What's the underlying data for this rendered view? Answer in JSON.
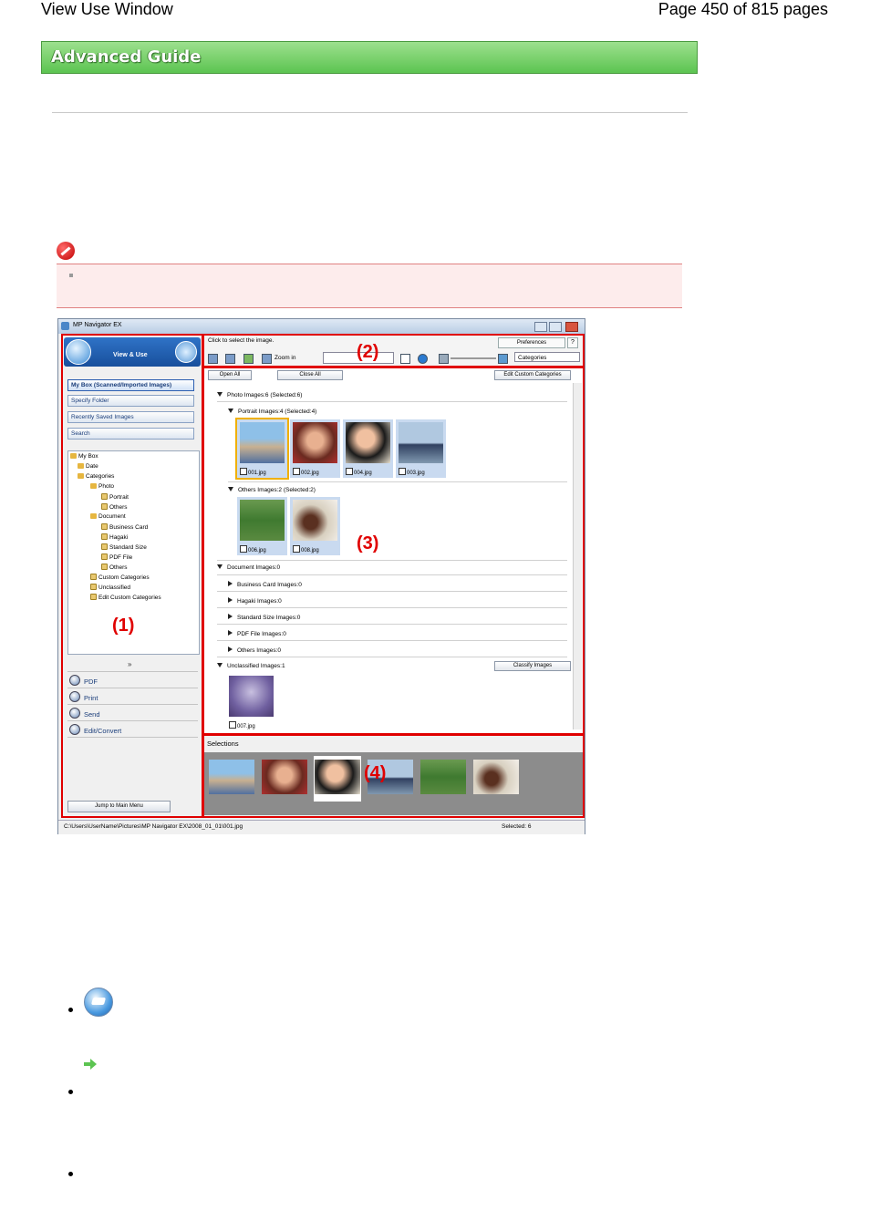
{
  "page_header": {
    "left": "View Use Window",
    "right": "Page 450 of 815 pages"
  },
  "banner": {
    "title": "Advanced Guide"
  },
  "screenshot": {
    "title": "MP Navigator EX",
    "left_panel": {
      "mode_label": "View & Use",
      "buttons": [
        "My Box (Scanned/Imported Images)",
        "Specify Folder",
        "Recently Saved Images",
        "Search"
      ],
      "tree": [
        "My Box",
        "Date",
        "Categories",
        "Photo",
        "Portrait",
        "Others",
        "Document",
        "Business Card",
        "Hagaki",
        "Standard Size",
        "PDF File",
        "Others",
        "Custom Categories",
        "Unclassified",
        "Edit Custom Categories"
      ],
      "actions": [
        "PDF",
        "Print",
        "Send",
        "Edit/Convert"
      ],
      "jump_button": "Jump to Main Menu"
    },
    "toolbar": {
      "hint": "Click to select the image.",
      "preferences": "Preferences",
      "help": "?",
      "zoom": "Zoom in",
      "category_select": "Categories"
    },
    "content": {
      "open_all": "Open All",
      "close_all": "Close All",
      "edit_custom": "Edit Custom Categories",
      "classify": "Classify Images",
      "sections": [
        "Photo    Images:6    (Selected:6)",
        "Portrait    Images:4    (Selected:4)",
        "Others    Images:2    (Selected:2)",
        "Document    Images:0",
        "Business Card    Images:0",
        "Hagaki    Images:0",
        "Standard Size    Images:0",
        "PDF File    Images:0",
        "Others    Images:0",
        "Unclassified    Images:1"
      ],
      "files": [
        "001.jpg",
        "002.jpg",
        "004.jpg",
        "003.jpg",
        "006.jpg",
        "008.jpg",
        "007.jpg"
      ]
    },
    "selections_label": "Selections",
    "status": {
      "path": "C:\\Users\\UserName\\Pictures\\MP Navigator EX\\2008_01_01\\001.jpg",
      "selected": "Selected: 6"
    },
    "region_numbers": [
      "(1)",
      "(2)",
      "(3)",
      "(4)"
    ]
  },
  "colors": {
    "banner": "#5cc451",
    "highlight": "#e00000",
    "accent": "#2f73c7"
  }
}
